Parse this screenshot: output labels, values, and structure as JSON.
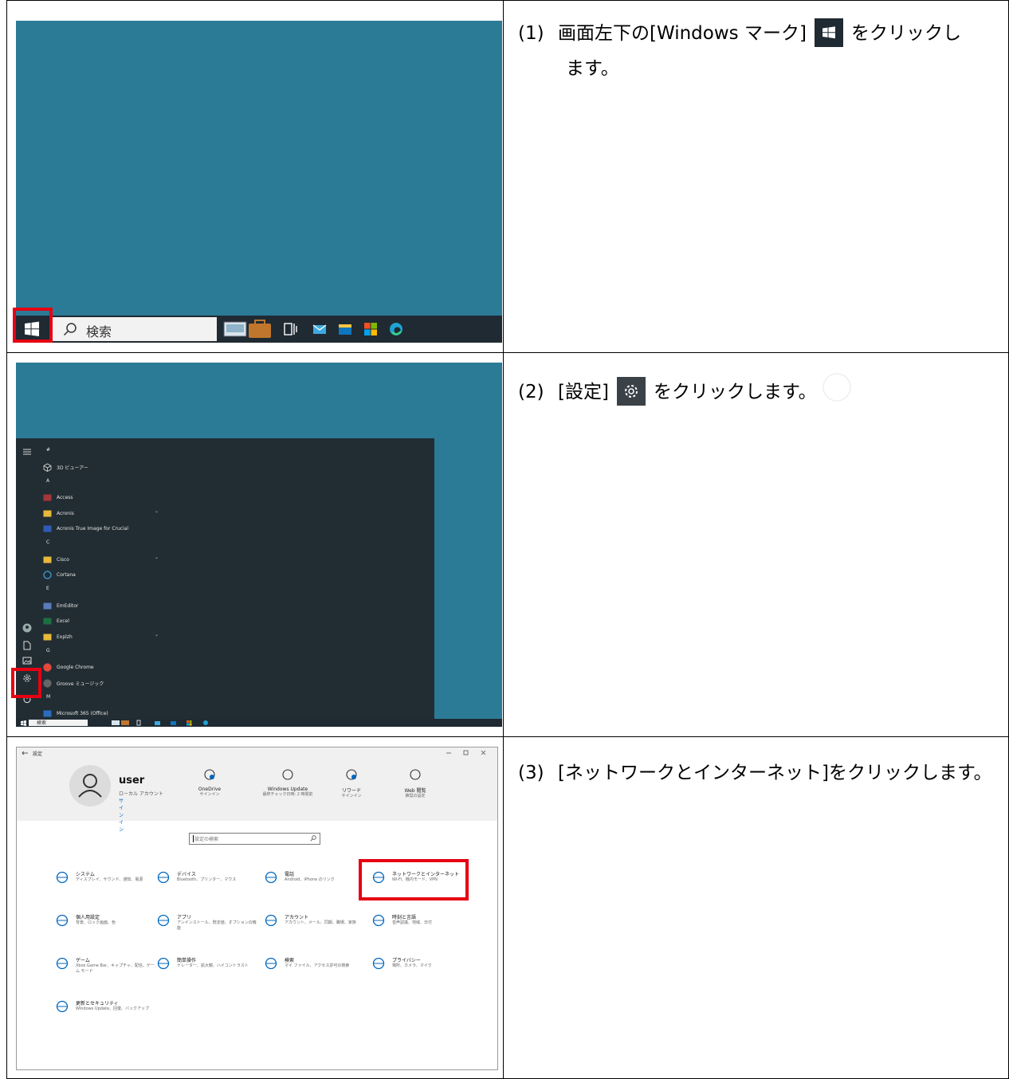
{
  "steps": [
    {
      "number": "(1)",
      "before": "画面左下の[Windows マーク]",
      "after": "をクリックし",
      "line2": "ます。"
    },
    {
      "number": "(2)",
      "before": "[設定]",
      "after": "をクリックします。"
    },
    {
      "number": "(3)",
      "text": "[ネットワークとインターネット]をクリックします。"
    }
  ],
  "shot1": {
    "search_placeholder": "検索"
  },
  "shot2": {
    "items": [
      {
        "type": "letter",
        "label": "#"
      },
      {
        "type": "app",
        "label": "3D ビューアー",
        "icon": "cube-icon"
      },
      {
        "type": "letter",
        "label": "A"
      },
      {
        "type": "app",
        "label": "Access",
        "icon": "access-icon"
      },
      {
        "type": "app",
        "label": "Acronis",
        "icon": "folder-icon",
        "expand": true
      },
      {
        "type": "app",
        "label": "Acronis True Image for Crucial",
        "icon": "acronis-icon"
      },
      {
        "type": "letter",
        "label": "C"
      },
      {
        "type": "app",
        "label": "Cisco",
        "icon": "folder-icon",
        "expand": true
      },
      {
        "type": "app",
        "label": "Cortana",
        "icon": "cortana-icon"
      },
      {
        "type": "letter",
        "label": "E"
      },
      {
        "type": "app",
        "label": "EmEditor",
        "icon": "emeditor-icon"
      },
      {
        "type": "app",
        "label": "Excel",
        "icon": "excel-icon"
      },
      {
        "type": "app",
        "label": "Explzh",
        "icon": "folder-icon",
        "expand": true
      },
      {
        "type": "letter",
        "label": "G"
      },
      {
        "type": "app",
        "label": "Google Chrome",
        "icon": "chrome-icon"
      },
      {
        "type": "app",
        "label": "Groove ミュージック",
        "icon": "groove-icon"
      },
      {
        "type": "letter",
        "label": "M"
      },
      {
        "type": "app",
        "label": "Microsoft 365 (Office)",
        "icon": "office-icon"
      }
    ],
    "search_placeholder": "検索"
  },
  "shot3": {
    "window_title": "設定",
    "user": {
      "name": "user",
      "account": "ローカル アカウント",
      "signin": "サインイン"
    },
    "top_items": [
      {
        "title": "OneDrive",
        "sub": "サインイン",
        "icon": "onedrive-icon"
      },
      {
        "title": "Windows Update",
        "sub": "最終チェック日時: 2 時間前",
        "icon": "windows-update-icon"
      },
      {
        "title": "リワード",
        "sub": "サインイン",
        "icon": "rewards-icon"
      },
      {
        "title": "Web 閲覧",
        "sub": "推奨の設定",
        "icon": "globe-icon"
      }
    ],
    "search_placeholder": "設定の検索",
    "tiles": [
      {
        "title": "システム",
        "sub": "ディスプレイ、サウンド、通知、電源",
        "icon": "laptop-icon"
      },
      {
        "title": "デバイス",
        "sub": "Bluetooth、プリンター、マウス",
        "icon": "devices-icon"
      },
      {
        "title": "電話",
        "sub": "Android、iPhone のリンク",
        "icon": "phone-icon"
      },
      {
        "title": "ネットワークとインターネット",
        "sub": "Wi-Fi、機内モード、VPN",
        "icon": "globe-icon"
      },
      {
        "title": "個人用設定",
        "sub": "背景、ロック画面、色",
        "icon": "personalize-icon"
      },
      {
        "title": "アプリ",
        "sub": "アンインストール、既定値、オプションの機能",
        "icon": "apps-icon"
      },
      {
        "title": "アカウント",
        "sub": "アカウント、メール、同期、職場、家族",
        "icon": "account-icon"
      },
      {
        "title": "時刻と言語",
        "sub": "音声認識、地域、日付",
        "icon": "time-language-icon"
      },
      {
        "title": "ゲーム",
        "sub": "Xbox Game Bar、キャプチャ、配信、ゲーム モード",
        "icon": "xbox-icon"
      },
      {
        "title": "簡単操作",
        "sub": "ナレーター、拡大鏡、ハイコントラスト",
        "icon": "ease-of-access-icon"
      },
      {
        "title": "検索",
        "sub": "マイ ファイル、アクセス許可の検索",
        "icon": "search-icon"
      },
      {
        "title": "プライバシー",
        "sub": "場所、カメラ、マイク",
        "icon": "lock-icon"
      },
      {
        "title": "更新とセキュリティ",
        "sub": "Windows Update、回復、バックアップ",
        "icon": "sync-icon"
      }
    ]
  },
  "colors": {
    "desktop": "#2b7b97",
    "taskbar": "#1f2a32",
    "highlight": "#e60012",
    "start_menu": "#222d33"
  }
}
